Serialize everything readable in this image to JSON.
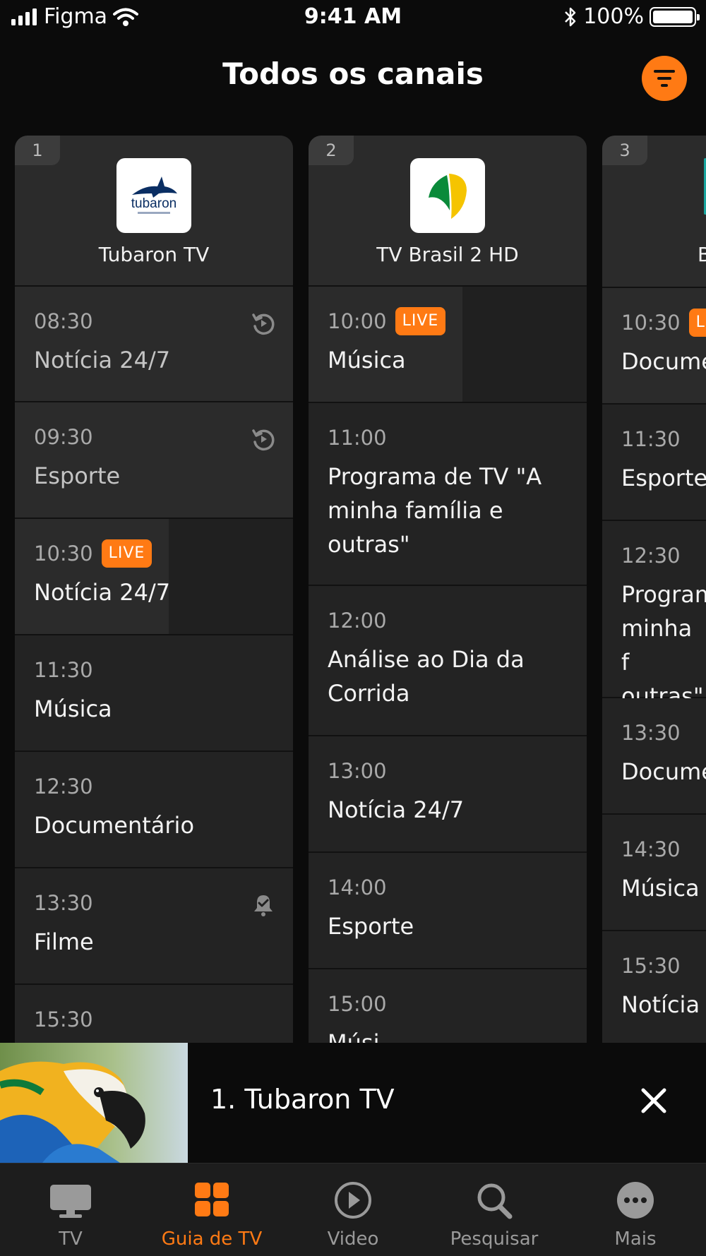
{
  "status_bar": {
    "carrier": "Figma",
    "time": "9:41 AM",
    "battery": "100%"
  },
  "header": {
    "title": "Todos os canais"
  },
  "channels": [
    {
      "number": "1",
      "name": "Tubaron TV",
      "logo_text": "tubaron",
      "programs": [
        {
          "time": "08:30",
          "title": "Notícia 24/7",
          "icon": "replay-icon"
        },
        {
          "time": "09:30",
          "title": "Esporte",
          "icon": "replay-icon"
        },
        {
          "time": "10:30",
          "title": "Notícia 24/7",
          "badge": "LIVE"
        },
        {
          "time": "11:30",
          "title": "Música"
        },
        {
          "time": "12:30",
          "title": "Documentário"
        },
        {
          "time": "13:30",
          "title": "Filme",
          "icon": "bell-check-icon"
        },
        {
          "time": "15:30",
          "title": ""
        }
      ]
    },
    {
      "number": "2",
      "name": "TV Brasil 2 HD",
      "programs": [
        {
          "time": "10:00",
          "title": "Música",
          "badge": "LIVE"
        },
        {
          "time": "11:00",
          "title": "Programa de TV \"A minha família e outras\""
        },
        {
          "time": "12:00",
          "title": "Análise ao Dia da Corrida"
        },
        {
          "time": "13:00",
          "title": "Notícia 24/7"
        },
        {
          "time": "14:00",
          "title": "Esporte"
        },
        {
          "time": "15:00",
          "title": "Músi"
        }
      ]
    },
    {
      "number": "3",
      "name": "B",
      "programs": [
        {
          "time": "10:30",
          "title": "Docume",
          "badge": "L"
        },
        {
          "time": "11:30",
          "title": "Esporte"
        },
        {
          "time": "12:30",
          "title": "Program minha f outras\""
        },
        {
          "time": "13:30",
          "title": "Docume"
        },
        {
          "time": "14:30",
          "title": "Música"
        },
        {
          "time": "15:30",
          "title": "Notícia"
        }
      ]
    }
  ],
  "mini_player": {
    "title": "1. Tubaron TV"
  },
  "tabs": [
    {
      "label": "TV",
      "icon": "tv-icon",
      "active": false
    },
    {
      "label": "Guia de TV",
      "icon": "grid-icon",
      "active": true
    },
    {
      "label": "Video",
      "icon": "play-circle-icon",
      "active": false
    },
    {
      "label": "Pesquisar",
      "icon": "search-icon",
      "active": false
    },
    {
      "label": "Mais",
      "icon": "more-icon",
      "active": false
    }
  ],
  "colors": {
    "accent": "#ff7a14",
    "background": "#0b0b0b",
    "card": "#232323"
  }
}
